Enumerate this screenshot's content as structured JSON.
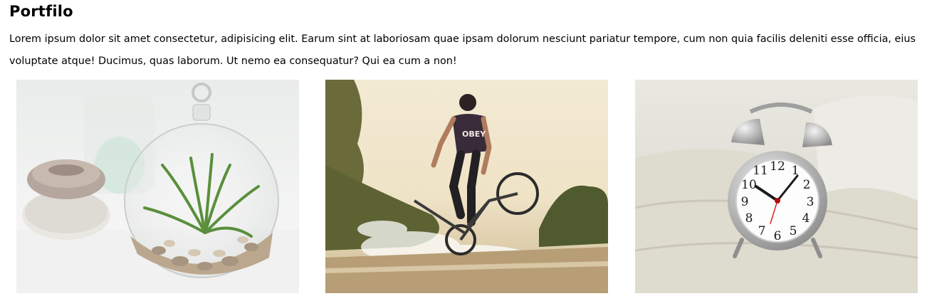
{
  "portfolio": {
    "title": "Portfilo",
    "description": "Lorem ipsum dolor sit amet consectetur, adipisicing elit. Earum sint at laboriosam quae ipsam dolorum nesciunt pariatur tempore, cum non quia facilis deleniti esse officia, eius voluptate atque! Ducimus, quas laborum. Ut nemo ea consequatur? Qui ea cum a non!",
    "images": [
      {
        "subject": "air-plant-terrarium",
        "shirt_text": ""
      },
      {
        "subject": "bmx-rider-splash",
        "shirt_text": "OBEY"
      },
      {
        "subject": "alarm-clock-on-bed",
        "shirt_text": ""
      }
    ],
    "clock_numerals": [
      "12",
      "1",
      "2",
      "3",
      "4",
      "5",
      "6",
      "7",
      "8",
      "9",
      "10",
      "11"
    ]
  }
}
